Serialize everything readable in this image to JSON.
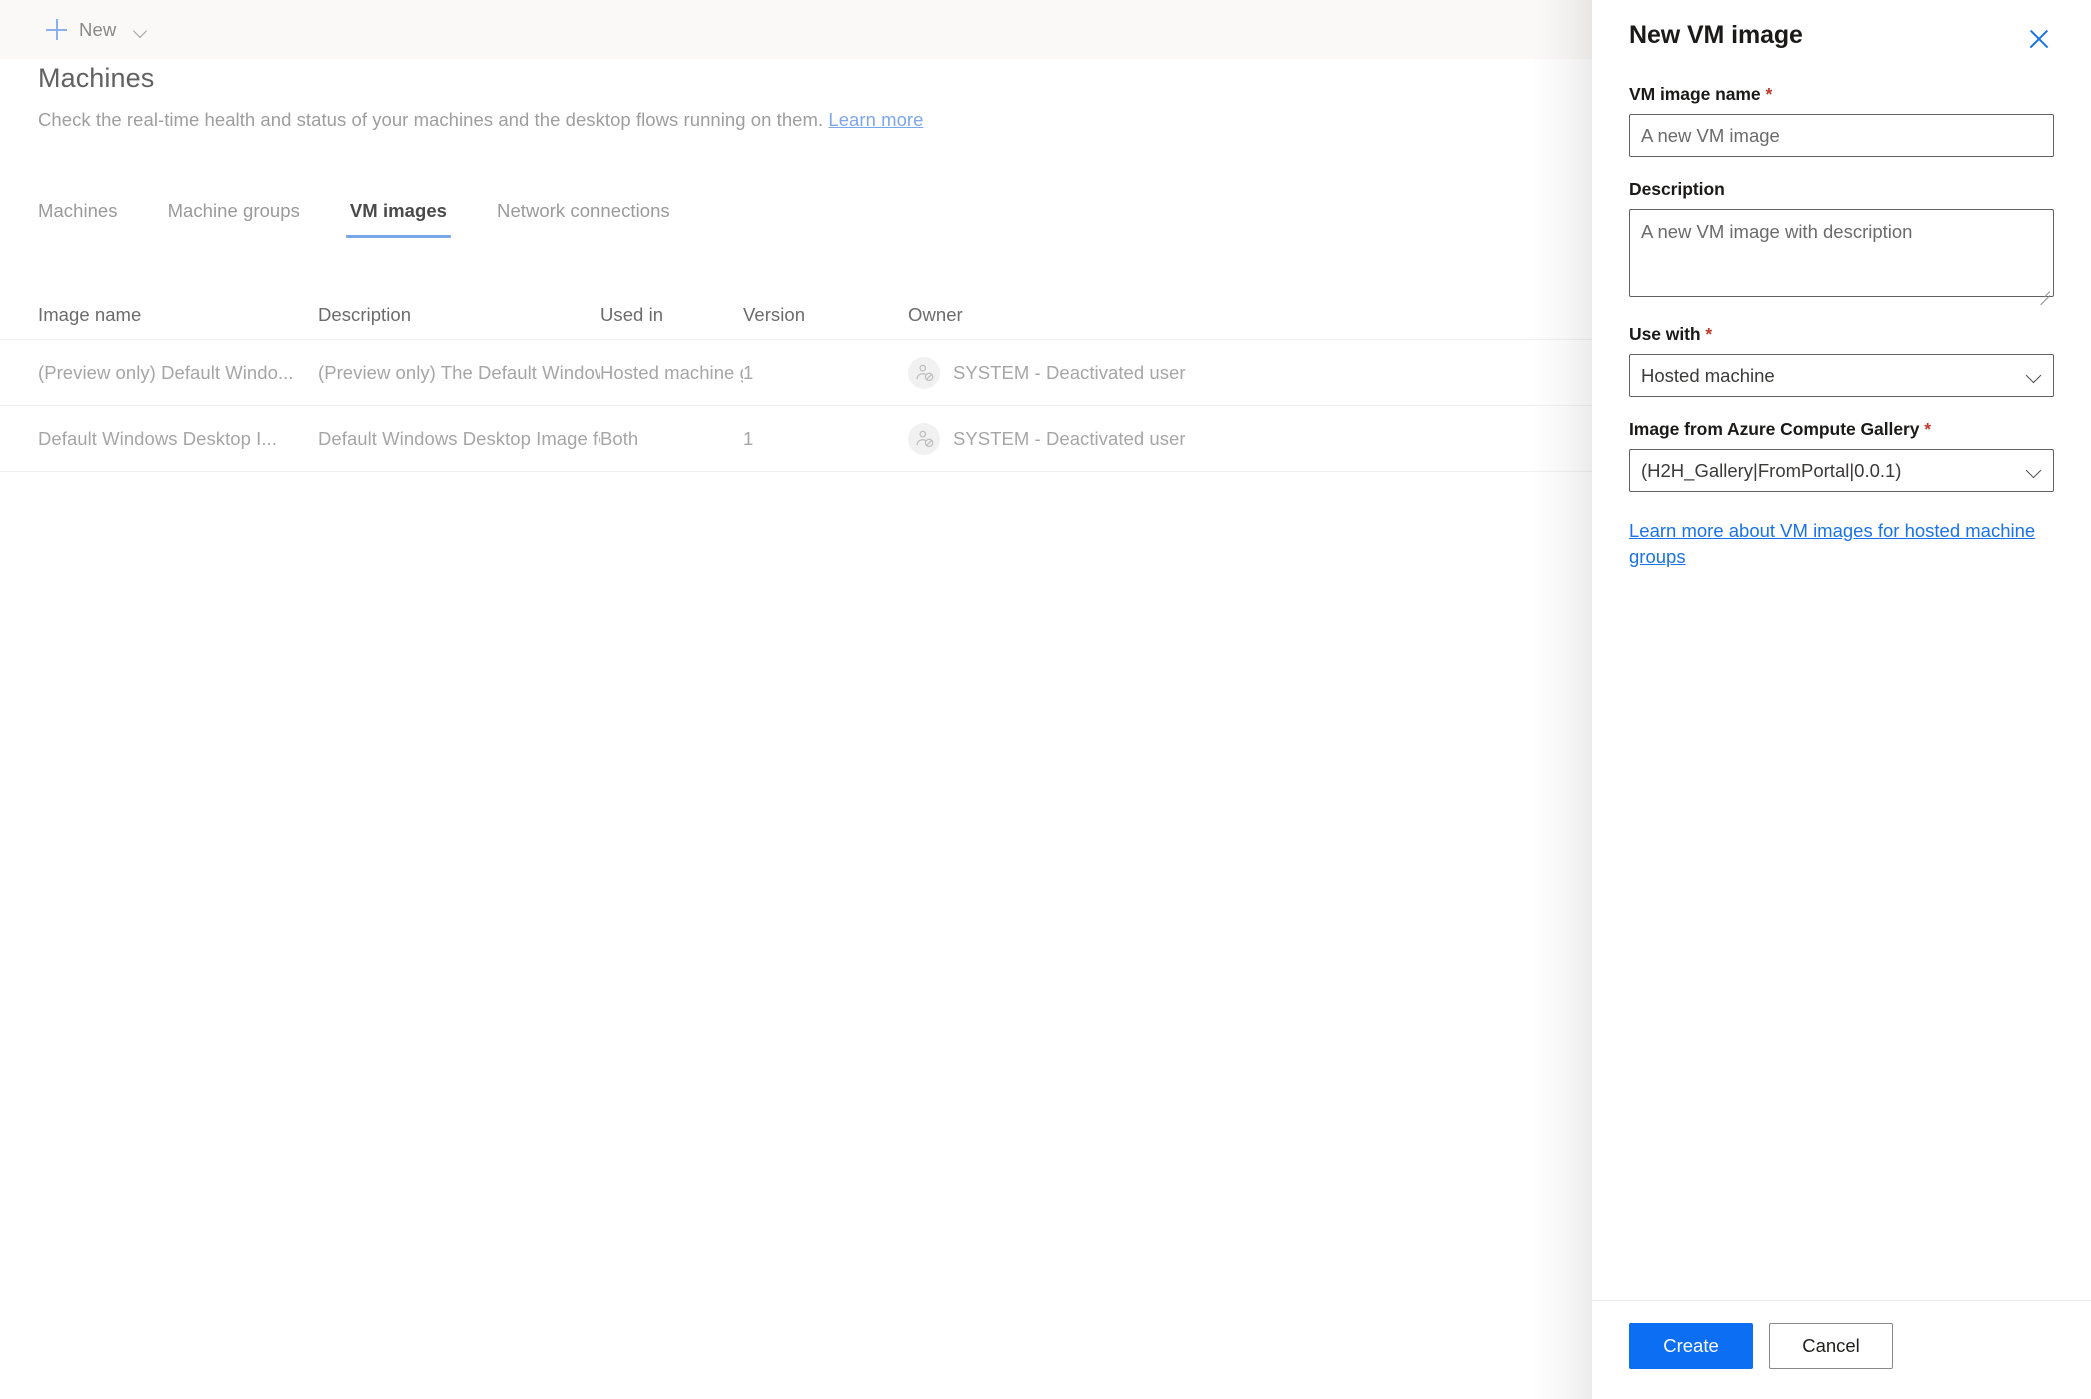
{
  "commandbar": {
    "new_label": "New",
    "plus_icon": "plus-icon",
    "chevron_icon": "chevron-down-icon"
  },
  "page": {
    "title": "Machines",
    "subtitle_text": "Check the real-time health and status of your machines and the desktop flows running on them.",
    "subtitle_link": "Learn more"
  },
  "tabs": [
    {
      "label": "Machines",
      "active": false
    },
    {
      "label": "Machine groups",
      "active": false
    },
    {
      "label": "VM images",
      "active": true
    },
    {
      "label": "Network connections",
      "active": false
    }
  ],
  "table": {
    "columns": [
      "Image name",
      "Description",
      "Used in",
      "Version",
      "Owner"
    ],
    "rows": [
      {
        "image_name": "(Preview only) Default Windo...",
        "description": "(Preview only) The Default Windows Desk...",
        "used_in": "Hosted machine group",
        "version": "1",
        "owner": "SYSTEM - Deactivated user",
        "owner_icon": "deactivated-user-avatar-icon"
      },
      {
        "image_name": "Default Windows Desktop I...",
        "description": "Default Windows Desktop Image for use i...",
        "used_in": "Both",
        "version": "1",
        "owner": "SYSTEM - Deactivated user",
        "owner_icon": "deactivated-user-avatar-icon"
      }
    ]
  },
  "panel": {
    "title": "New VM image",
    "close_icon": "close-icon",
    "fields": {
      "vm_image_name": {
        "label": "VM image name",
        "required_marker": "*",
        "value": "A new VM image",
        "placeholder": "A new VM image"
      },
      "description": {
        "label": "Description",
        "required_marker": "",
        "value": "A new VM image with description",
        "placeholder": "A new VM image with description"
      },
      "use_with": {
        "label": "Use with",
        "required_marker": "*",
        "value": "Hosted machine",
        "chevron_icon": "chevron-down-icon"
      },
      "gallery_image": {
        "label": "Image from Azure Compute Gallery",
        "required_marker": "*",
        "value": "(H2H_Gallery|FromPortal|0.0.1)",
        "chevron_icon": "chevron-down-icon"
      }
    },
    "help_link": "Learn more about VM images for hosted machine groups",
    "buttons": {
      "create": "Create",
      "cancel": "Cancel"
    }
  },
  "colors": {
    "accent_blue": "#0c6ef2",
    "link_blue": "#1a73e8",
    "tab_underline": "#7aa7e8",
    "required_red": "#c0392b",
    "commandbar_bg": "#faf9f8"
  }
}
